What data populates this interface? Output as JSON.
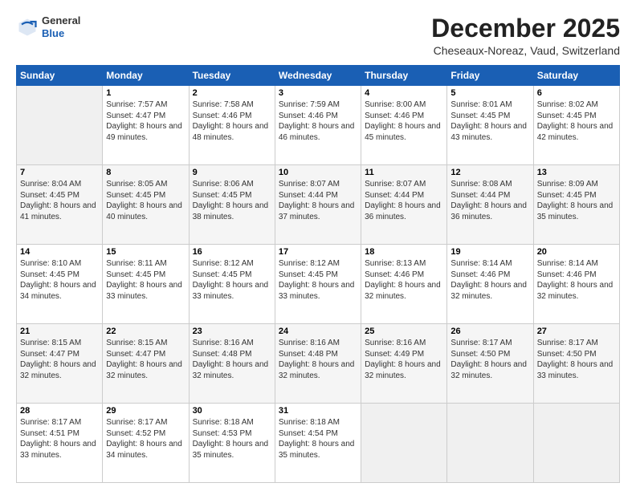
{
  "header": {
    "logo": {
      "line1": "General",
      "line2": "Blue"
    },
    "title": "December 2025",
    "location": "Cheseaux-Noreaz, Vaud, Switzerland"
  },
  "days_of_week": [
    "Sunday",
    "Monday",
    "Tuesday",
    "Wednesday",
    "Thursday",
    "Friday",
    "Saturday"
  ],
  "weeks": [
    [
      {
        "day": "",
        "sunrise": "",
        "sunset": "",
        "daylight": ""
      },
      {
        "day": "1",
        "sunrise": "Sunrise: 7:57 AM",
        "sunset": "Sunset: 4:47 PM",
        "daylight": "Daylight: 8 hours and 49 minutes."
      },
      {
        "day": "2",
        "sunrise": "Sunrise: 7:58 AM",
        "sunset": "Sunset: 4:46 PM",
        "daylight": "Daylight: 8 hours and 48 minutes."
      },
      {
        "day": "3",
        "sunrise": "Sunrise: 7:59 AM",
        "sunset": "Sunset: 4:46 PM",
        "daylight": "Daylight: 8 hours and 46 minutes."
      },
      {
        "day": "4",
        "sunrise": "Sunrise: 8:00 AM",
        "sunset": "Sunset: 4:46 PM",
        "daylight": "Daylight: 8 hours and 45 minutes."
      },
      {
        "day": "5",
        "sunrise": "Sunrise: 8:01 AM",
        "sunset": "Sunset: 4:45 PM",
        "daylight": "Daylight: 8 hours and 43 minutes."
      },
      {
        "day": "6",
        "sunrise": "Sunrise: 8:02 AM",
        "sunset": "Sunset: 4:45 PM",
        "daylight": "Daylight: 8 hours and 42 minutes."
      }
    ],
    [
      {
        "day": "7",
        "sunrise": "Sunrise: 8:04 AM",
        "sunset": "Sunset: 4:45 PM",
        "daylight": "Daylight: 8 hours and 41 minutes."
      },
      {
        "day": "8",
        "sunrise": "Sunrise: 8:05 AM",
        "sunset": "Sunset: 4:45 PM",
        "daylight": "Daylight: 8 hours and 40 minutes."
      },
      {
        "day": "9",
        "sunrise": "Sunrise: 8:06 AM",
        "sunset": "Sunset: 4:45 PM",
        "daylight": "Daylight: 8 hours and 38 minutes."
      },
      {
        "day": "10",
        "sunrise": "Sunrise: 8:07 AM",
        "sunset": "Sunset: 4:44 PM",
        "daylight": "Daylight: 8 hours and 37 minutes."
      },
      {
        "day": "11",
        "sunrise": "Sunrise: 8:07 AM",
        "sunset": "Sunset: 4:44 PM",
        "daylight": "Daylight: 8 hours and 36 minutes."
      },
      {
        "day": "12",
        "sunrise": "Sunrise: 8:08 AM",
        "sunset": "Sunset: 4:44 PM",
        "daylight": "Daylight: 8 hours and 36 minutes."
      },
      {
        "day": "13",
        "sunrise": "Sunrise: 8:09 AM",
        "sunset": "Sunset: 4:45 PM",
        "daylight": "Daylight: 8 hours and 35 minutes."
      }
    ],
    [
      {
        "day": "14",
        "sunrise": "Sunrise: 8:10 AM",
        "sunset": "Sunset: 4:45 PM",
        "daylight": "Daylight: 8 hours and 34 minutes."
      },
      {
        "day": "15",
        "sunrise": "Sunrise: 8:11 AM",
        "sunset": "Sunset: 4:45 PM",
        "daylight": "Daylight: 8 hours and 33 minutes."
      },
      {
        "day": "16",
        "sunrise": "Sunrise: 8:12 AM",
        "sunset": "Sunset: 4:45 PM",
        "daylight": "Daylight: 8 hours and 33 minutes."
      },
      {
        "day": "17",
        "sunrise": "Sunrise: 8:12 AM",
        "sunset": "Sunset: 4:45 PM",
        "daylight": "Daylight: 8 hours and 33 minutes."
      },
      {
        "day": "18",
        "sunrise": "Sunrise: 8:13 AM",
        "sunset": "Sunset: 4:46 PM",
        "daylight": "Daylight: 8 hours and 32 minutes."
      },
      {
        "day": "19",
        "sunrise": "Sunrise: 8:14 AM",
        "sunset": "Sunset: 4:46 PM",
        "daylight": "Daylight: 8 hours and 32 minutes."
      },
      {
        "day": "20",
        "sunrise": "Sunrise: 8:14 AM",
        "sunset": "Sunset: 4:46 PM",
        "daylight": "Daylight: 8 hours and 32 minutes."
      }
    ],
    [
      {
        "day": "21",
        "sunrise": "Sunrise: 8:15 AM",
        "sunset": "Sunset: 4:47 PM",
        "daylight": "Daylight: 8 hours and 32 minutes."
      },
      {
        "day": "22",
        "sunrise": "Sunrise: 8:15 AM",
        "sunset": "Sunset: 4:47 PM",
        "daylight": "Daylight: 8 hours and 32 minutes."
      },
      {
        "day": "23",
        "sunrise": "Sunrise: 8:16 AM",
        "sunset": "Sunset: 4:48 PM",
        "daylight": "Daylight: 8 hours and 32 minutes."
      },
      {
        "day": "24",
        "sunrise": "Sunrise: 8:16 AM",
        "sunset": "Sunset: 4:48 PM",
        "daylight": "Daylight: 8 hours and 32 minutes."
      },
      {
        "day": "25",
        "sunrise": "Sunrise: 8:16 AM",
        "sunset": "Sunset: 4:49 PM",
        "daylight": "Daylight: 8 hours and 32 minutes."
      },
      {
        "day": "26",
        "sunrise": "Sunrise: 8:17 AM",
        "sunset": "Sunset: 4:50 PM",
        "daylight": "Daylight: 8 hours and 32 minutes."
      },
      {
        "day": "27",
        "sunrise": "Sunrise: 8:17 AM",
        "sunset": "Sunset: 4:50 PM",
        "daylight": "Daylight: 8 hours and 33 minutes."
      }
    ],
    [
      {
        "day": "28",
        "sunrise": "Sunrise: 8:17 AM",
        "sunset": "Sunset: 4:51 PM",
        "daylight": "Daylight: 8 hours and 33 minutes."
      },
      {
        "day": "29",
        "sunrise": "Sunrise: 8:17 AM",
        "sunset": "Sunset: 4:52 PM",
        "daylight": "Daylight: 8 hours and 34 minutes."
      },
      {
        "day": "30",
        "sunrise": "Sunrise: 8:18 AM",
        "sunset": "Sunset: 4:53 PM",
        "daylight": "Daylight: 8 hours and 35 minutes."
      },
      {
        "day": "31",
        "sunrise": "Sunrise: 8:18 AM",
        "sunset": "Sunset: 4:54 PM",
        "daylight": "Daylight: 8 hours and 35 minutes."
      },
      {
        "day": "",
        "sunrise": "",
        "sunset": "",
        "daylight": ""
      },
      {
        "day": "",
        "sunrise": "",
        "sunset": "",
        "daylight": ""
      },
      {
        "day": "",
        "sunrise": "",
        "sunset": "",
        "daylight": ""
      }
    ]
  ]
}
